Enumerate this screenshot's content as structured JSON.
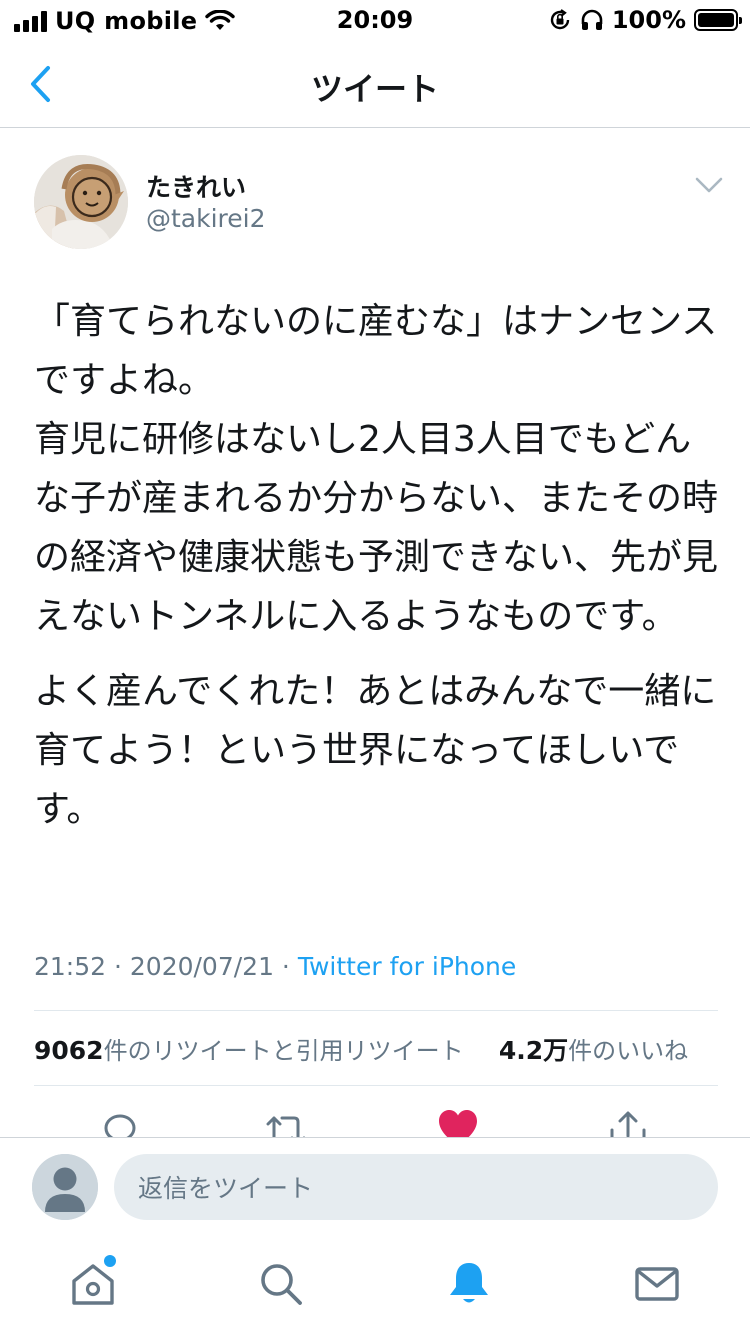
{
  "status_bar": {
    "carrier": "UQ mobile",
    "time": "20:09",
    "battery": "100%"
  },
  "nav": {
    "title": "ツイート"
  },
  "tweet": {
    "author_name": "たきれい",
    "author_handle": "@takirei2",
    "paragraphs": [
      "「育てられないのに産むな」はナンセンスですよね。\n育児に研修はないし2人目3人目でもどんな子が産まれるか分からない、またその時の経済や健康状態も予測できない、先が見えないトンネルに入るようなものです。",
      "よく産んでくれた！あとはみんなで一緒に育てよう！という世界になってほしいです。"
    ],
    "timestamp": "21:52 · 2020/07/21 · ",
    "source": "Twitter for iPhone",
    "retweet_count": "9062",
    "retweet_label": "件のリツイートと引用リツイート",
    "like_count": "4.2万",
    "like_label": "件のいいね"
  },
  "composer": {
    "placeholder": "返信をツイート"
  },
  "tabs": [
    "home-icon",
    "search-icon",
    "notifications-icon",
    "messages-icon"
  ],
  "colors": {
    "accent": "#1da1f2",
    "like": "#e0245e",
    "secondary_text": "#657786"
  }
}
